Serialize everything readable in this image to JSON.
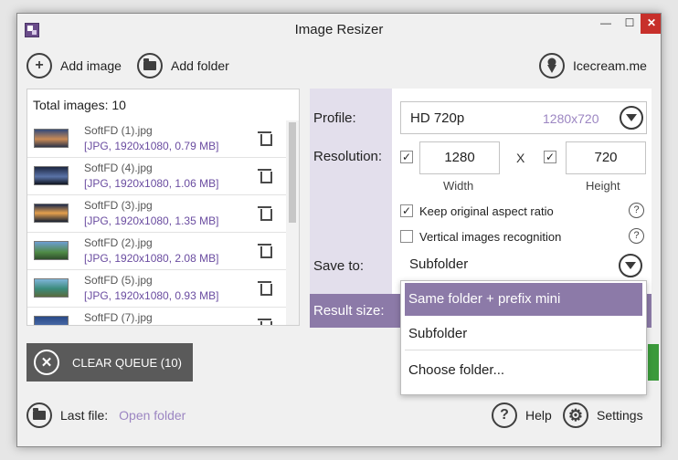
{
  "window": {
    "title": "Image Resizer",
    "controls": {
      "minimize": "—",
      "maximize": "☐",
      "close": "✕"
    }
  },
  "toolbar": {
    "add_image": "Add image",
    "add_folder": "Add folder",
    "brand_link": "Icecream.me"
  },
  "queue": {
    "total_label": "Total images: 10",
    "items": [
      {
        "name": "SoftFD (1).jpg",
        "meta": "[JPG, 1920x1080, 0.79 MB]"
      },
      {
        "name": "SoftFD (4).jpg",
        "meta": "[JPG, 1920x1080, 1.06 MB]"
      },
      {
        "name": "SoftFD (3).jpg",
        "meta": "[JPG, 1920x1080, 1.35 MB]"
      },
      {
        "name": "SoftFD (2).jpg",
        "meta": "[JPG, 1920x1080, 2.08 MB]"
      },
      {
        "name": "SoftFD (5).jpg",
        "meta": "[JPG, 1920x1080, 0.93 MB]"
      },
      {
        "name": "SoftFD (7).jpg",
        "meta": ""
      }
    ],
    "clear_button": "CLEAR QUEUE (10)"
  },
  "settings": {
    "profile_label": "Profile:",
    "profile_value": "HD 720p",
    "profile_resolution": "1280x720",
    "resolution_label": "Resolution:",
    "width_value": "1280",
    "height_value": "720",
    "width_label": "Width",
    "height_label": "Height",
    "times_sign": "X",
    "width_checked": true,
    "height_checked": true,
    "keep_ratio": "Keep original aspect ratio",
    "keep_ratio_checked": true,
    "vertical_recognition": "Vertical images recognition",
    "vertical_checked": false,
    "help_mark": "?",
    "save_to_label": "Save to:",
    "save_to_value": "Subfolder",
    "result_label": "Result size:",
    "dropdown_options": [
      "Same folder + prefix mini",
      "Subfolder",
      "Choose folder..."
    ],
    "dropdown_selected_index": 0
  },
  "footer": {
    "last_file_label": "Last file:",
    "open_folder": "Open folder",
    "help": "Help",
    "settings": "Settings"
  },
  "icons": {
    "plus": "+",
    "close_x": "✕",
    "question": "?",
    "gear": "⚙",
    "check": "✓"
  },
  "colors": {
    "accent_purple": "#8c7aa8",
    "label_panel": "#e3dfec",
    "meta_text": "#6a4ca0",
    "muted_link": "#9c86c2",
    "clear_button_bg": "#5a5a5a",
    "close_red": "#c7302b",
    "go_green": "#3b9a3b"
  }
}
